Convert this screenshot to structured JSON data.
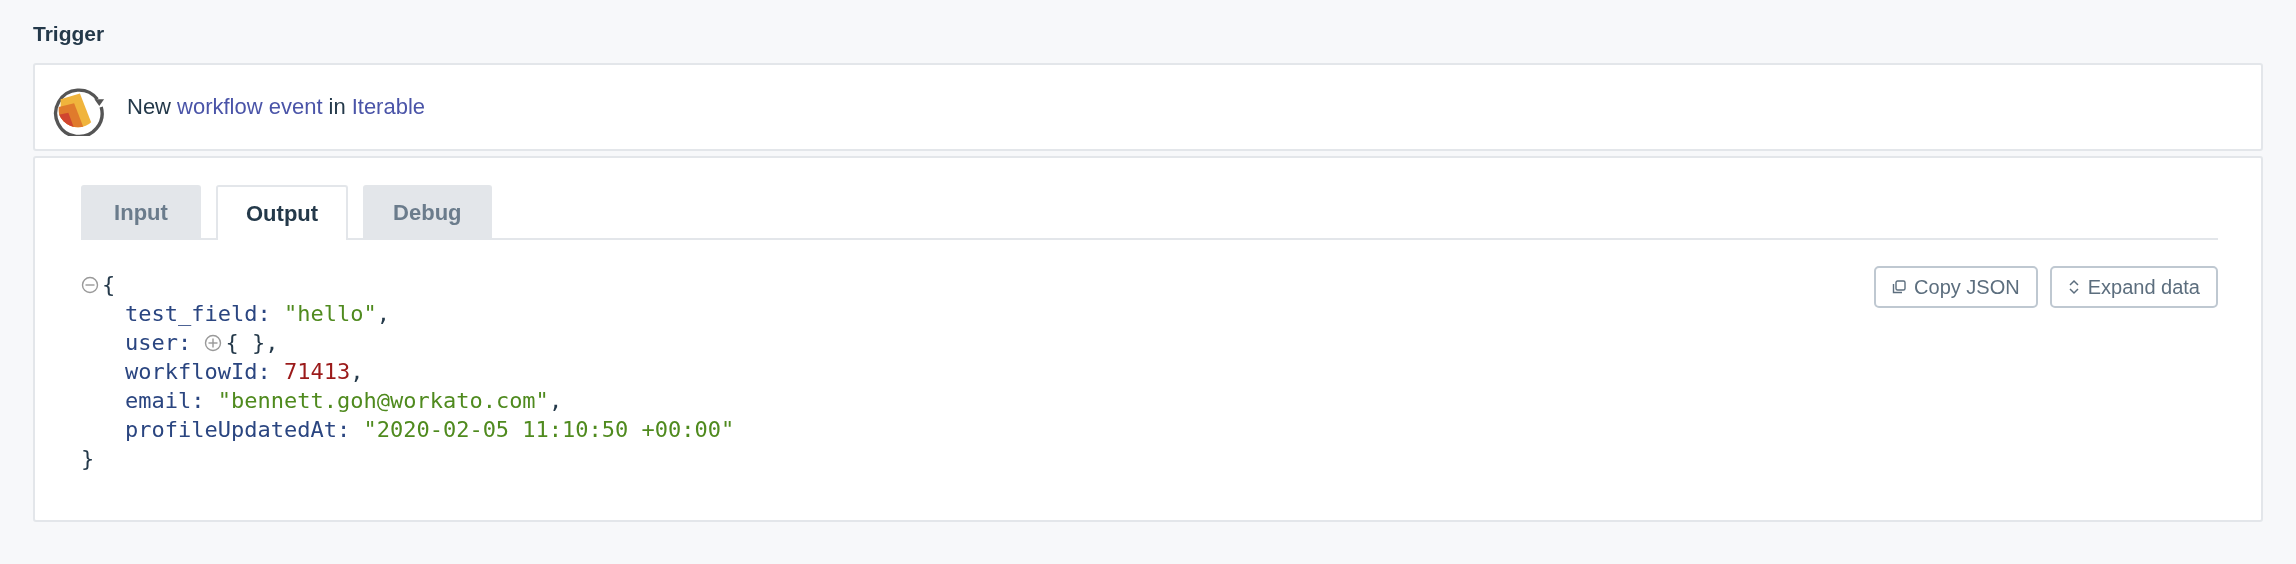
{
  "section_title": "Trigger",
  "trigger": {
    "parts": [
      {
        "text": "New",
        "kind": "plain"
      },
      {
        "text": "workflow event",
        "kind": "link"
      },
      {
        "text": "in",
        "kind": "plain"
      },
      {
        "text": "Iterable",
        "kind": "link"
      }
    ]
  },
  "tabs": [
    {
      "label": "Input",
      "selected": false
    },
    {
      "label": "Output",
      "selected": true
    },
    {
      "label": "Debug",
      "selected": false
    }
  ],
  "buttons": [
    {
      "label": "Copy JSON",
      "kind": "copy"
    },
    {
      "label": "Expand data",
      "kind": "expand"
    }
  ],
  "json": {
    "expanded": true,
    "open": "{",
    "close": "}",
    "fields": [
      {
        "key": "test_field:",
        "value": "\"hello\"",
        "kind": "string",
        "suffix": ","
      },
      {
        "key": "user:",
        "value": "{ }",
        "kind": "object",
        "expanded": false,
        "suffix": ","
      },
      {
        "key": "workflowId:",
        "value": "71413",
        "kind": "number",
        "suffix": ","
      },
      {
        "key": "email:",
        "value": "\"bennett.goh@workato.com\"",
        "kind": "string",
        "suffix": ","
      },
      {
        "key": "profileUpdatedAt:",
        "value": "\"2020-02-05 11:10:50 +00:00\"",
        "kind": "string"
      }
    ]
  }
}
